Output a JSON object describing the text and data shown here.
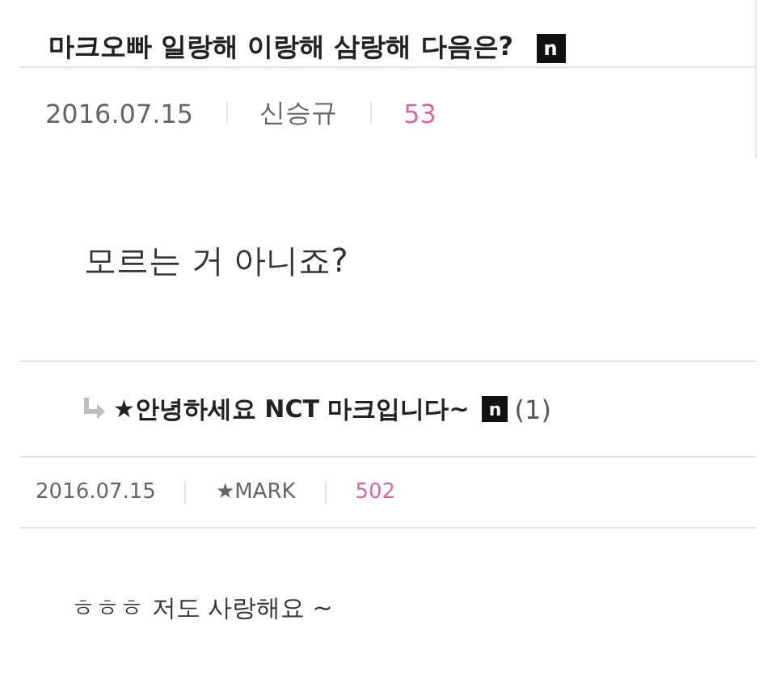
{
  "post": {
    "title": "마크오빠 일랑해 이랑해 삼랑해 다음은?",
    "badge": "n",
    "date": "2016.07.15",
    "author": "신승규",
    "views": "53",
    "body": "모르는 거 아니죠?"
  },
  "reply": {
    "title": "★안녕하세요 **NCT** 마크입니다~",
    "badge": "n",
    "comment_count": "(1)",
    "date": "2016.07.15",
    "author": "★MARK",
    "views": "502",
    "body": "ㅎㅎㅎ 저도 사랑해요 ~"
  }
}
